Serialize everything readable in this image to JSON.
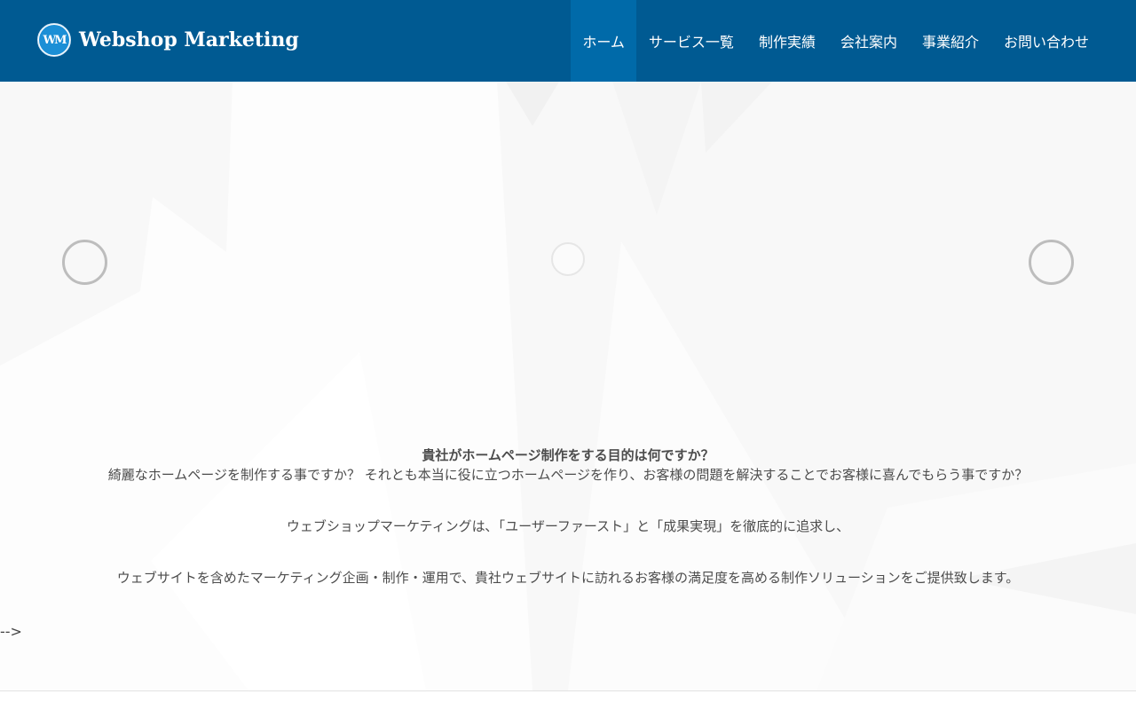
{
  "header": {
    "logo_mark": "WM",
    "logo_text": "Webshop Marketing",
    "brand_color": "#005a92",
    "active_color": "#006aa9"
  },
  "nav": {
    "items": [
      {
        "label": "ホーム",
        "active": true
      },
      {
        "label": "サービス一覧"
      },
      {
        "label": "制作実績"
      },
      {
        "label": "会社案内"
      },
      {
        "label": "事業紹介"
      },
      {
        "label": "お問い合わせ"
      }
    ]
  },
  "intro": {
    "heading": "貴社がホームページ制作をする目的は何ですか？",
    "line1": "綺麗なホームページを制作する事ですか？ それとも本当に役に立つホームページを作り、お客様の問題を解決することでお客様に喜んでもらう事ですか？",
    "line2": "ウェブショップマーケティングは､「ユーザーファースト」と「成果実現」を徹底的に追求し、",
    "line3": "ウェブサイトを含めたマーケティング企画・制作・運用で、貴社ウェブサイトに訪れるお客様の満足度を高める制作ソリューションをご提供致します。"
  },
  "stray_text": "-->",
  "icons": {
    "prev": "circle-prev-icon",
    "next": "circle-next-icon",
    "center": "circle-loader-icon"
  }
}
